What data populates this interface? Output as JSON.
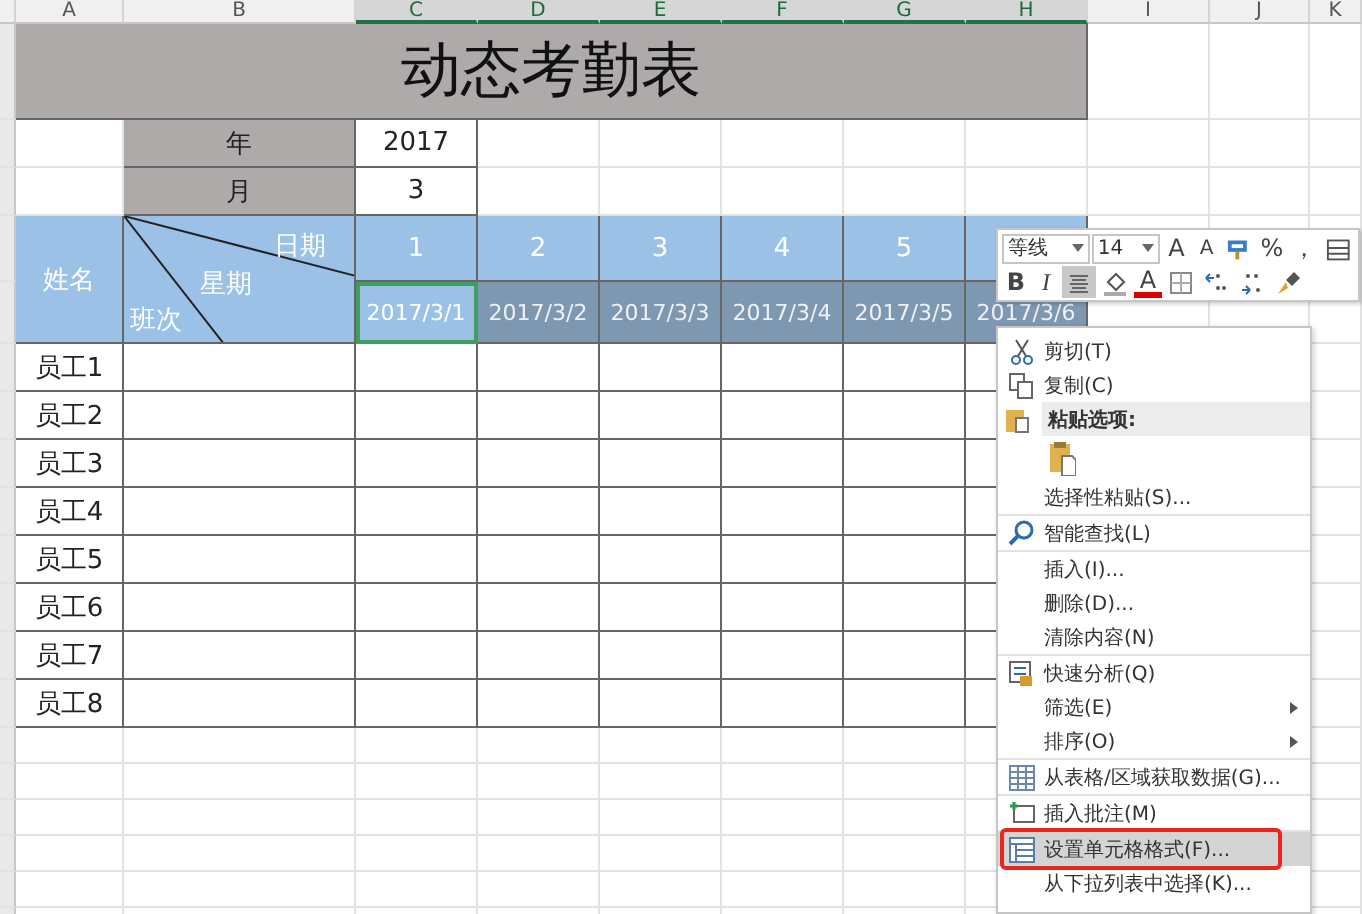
{
  "column_headers": [
    {
      "label": "A",
      "selected": false
    },
    {
      "label": "B",
      "selected": false
    },
    {
      "label": "C",
      "selected": true
    },
    {
      "label": "D",
      "selected": true
    },
    {
      "label": "E",
      "selected": true
    },
    {
      "label": "F",
      "selected": true
    },
    {
      "label": "G",
      "selected": true
    },
    {
      "label": "H",
      "selected": true
    },
    {
      "label": "I",
      "selected": false
    },
    {
      "label": "J",
      "selected": false
    },
    {
      "label": "K",
      "selected": false
    }
  ],
  "title": "动态考勤表",
  "year": {
    "label": "年",
    "value": "2017"
  },
  "month": {
    "label": "月",
    "value": "3"
  },
  "header": {
    "name_label": "姓名",
    "diagonal": {
      "top": "日期",
      "middle": "星期",
      "bottom": "班次"
    }
  },
  "days": [
    {
      "day": "1",
      "date": "2017/3/1",
      "selected": true,
      "active": true
    },
    {
      "day": "2",
      "date": "2017/3/2",
      "selected": true,
      "active": false
    },
    {
      "day": "3",
      "date": "2017/3/3",
      "selected": true,
      "active": false
    },
    {
      "day": "4",
      "date": "2017/3/4",
      "selected": true,
      "active": false
    },
    {
      "day": "5",
      "date": "2017/3/5",
      "selected": true,
      "active": false
    },
    {
      "date": "2017/3/6",
      "selected": true,
      "active": false
    }
  ],
  "employees": [
    "员工1",
    "员工2",
    "员工3",
    "员工4",
    "员工5",
    "员工6",
    "员工7",
    "员工8"
  ],
  "mini_toolbar": {
    "font": "等线",
    "size": "14",
    "row_1": [
      {
        "kind": "text",
        "label": "A",
        "pressed": false
      },
      {
        "kind": "text",
        "label": "A",
        "pressed": false
      },
      {
        "kind": "icon",
        "pressed": false
      },
      {
        "kind": "text",
        "label": "%",
        "pressed": false
      },
      {
        "kind": "text",
        "label": "，",
        "pressed": false
      },
      {
        "kind": "icon",
        "pressed": false
      }
    ],
    "row_2": [
      {
        "kind": "text",
        "label": "B",
        "pressed": false
      },
      {
        "kind": "text",
        "label": "I",
        "pressed": false
      },
      {
        "kind": "icon",
        "pressed": true
      },
      {
        "kind": "icon",
        "pressed": false
      },
      {
        "kind": "text",
        "label": "A",
        "pressed": false
      },
      {
        "kind": "icon",
        "pressed": false
      },
      {
        "kind": "icon",
        "pressed": false
      },
      {
        "kind": "icon",
        "pressed": false
      },
      {
        "kind": "icon",
        "pressed": false
      }
    ]
  },
  "context_menu": {
    "groups": [
      [
        {
          "kind": "item",
          "label": "剪切(T)",
          "selected": false,
          "submenu": false,
          "annotated": false
        },
        {
          "kind": "item",
          "label": "复制(C)",
          "selected": false,
          "submenu": false,
          "annotated": false
        },
        {
          "kind": "section",
          "label": "粘贴选项:",
          "selected": false,
          "submenu": false,
          "annotated": false
        },
        {
          "kind": "paste-option",
          "selected": false,
          "submenu": false,
          "annotated": false
        },
        {
          "kind": "item",
          "label": "选择性粘贴(S)...",
          "selected": false,
          "submenu": false,
          "annotated": false
        }
      ],
      [
        {
          "kind": "item",
          "label": "智能查找(L)",
          "selected": false,
          "submenu": false,
          "annotated": false
        }
      ],
      [
        {
          "kind": "item",
          "label": "插入(I)...",
          "selected": false,
          "submenu": false,
          "annotated": false
        },
        {
          "kind": "item",
          "label": "删除(D)...",
          "selected": false,
          "submenu": false,
          "annotated": false
        },
        {
          "kind": "item",
          "label": "清除内容(N)",
          "selected": false,
          "submenu": false,
          "annotated": false
        }
      ],
      [
        {
          "kind": "item",
          "label": "快速分析(Q)",
          "selected": false,
          "submenu": false,
          "annotated": false
        },
        {
          "kind": "item",
          "label": "筛选(E)",
          "selected": false,
          "submenu": true,
          "annotated": false
        },
        {
          "kind": "item",
          "label": "排序(O)",
          "selected": false,
          "submenu": true,
          "annotated": false
        }
      ],
      [
        {
          "kind": "item",
          "label": "从表格/区域获取数据(G)...",
          "selected": false,
          "submenu": false,
          "annotated": false
        }
      ],
      [
        {
          "kind": "item",
          "label": "插入批注(M)",
          "selected": false,
          "submenu": false,
          "annotated": false
        }
      ],
      [
        {
          "kind": "item",
          "label": "设置单元格格式(F)...",
          "selected": true,
          "submenu": false,
          "annotated": true
        },
        {
          "kind": "item",
          "label": "从下拉列表中选择(K)...",
          "selected": false,
          "submenu": false,
          "annotated": false
        }
      ]
    ]
  }
}
